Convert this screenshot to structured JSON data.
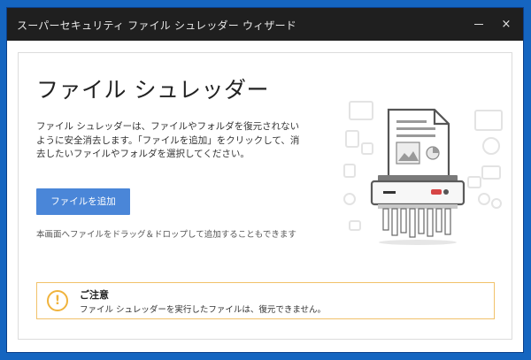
{
  "window": {
    "title": "スーパーセキュリティ ファイル シュレッダー ウィザード",
    "minimize_label": "—",
    "close_label": "×"
  },
  "main": {
    "heading": "ファイル シュレッダー",
    "description": "ファイル シュレッダーは、ファイルやフォルダを復元されないように安全消去します。「ファイルを追加」をクリックして、消去したいファイルやフォルダを選択してください。",
    "add_button_label": "ファイルを追加",
    "drag_hint": "本画面へファイルをドラッグ＆ドロップして追加することもできます"
  },
  "notice": {
    "icon": "warning-icon",
    "icon_glyph": "!",
    "title": "ご注意",
    "body": "ファイル シュレッダーを実行したファイルは、復元できません。"
  },
  "colors": {
    "accent": "#4a86d8",
    "titlebar": "#1f1f1f",
    "desktop": "#1565c0",
    "warning": "#f0b33c"
  }
}
